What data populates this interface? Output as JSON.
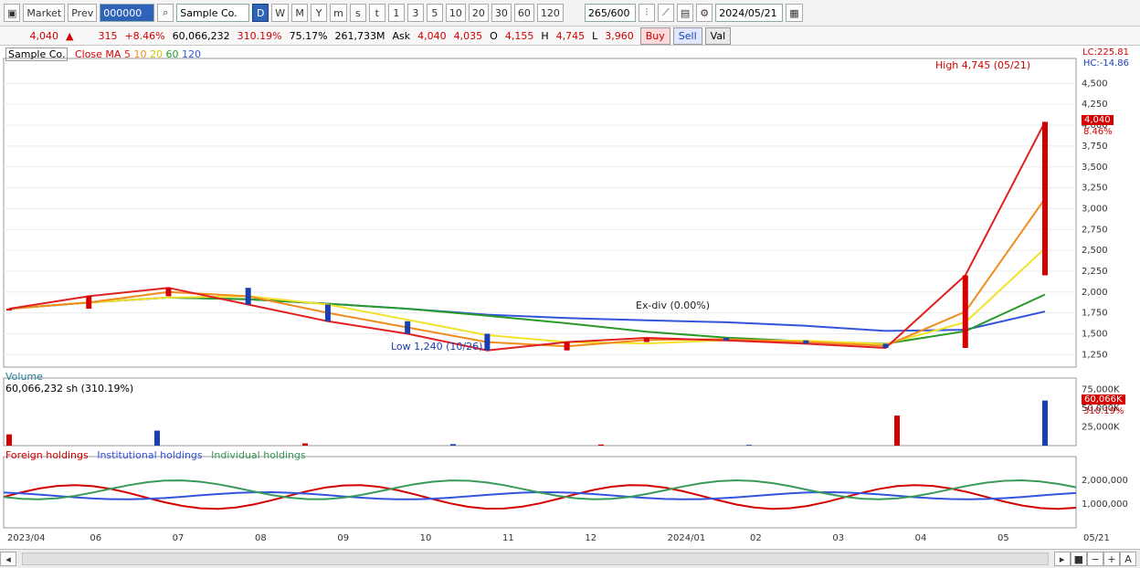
{
  "toolbar": {
    "market": "Market",
    "prev": "Prev",
    "code_value": "000000",
    "name_value": "Sample Co.",
    "periods": [
      "D",
      "W",
      "M",
      "Y",
      "m",
      "s",
      "t"
    ],
    "active_period": "D",
    "intervals": [
      "1",
      "3",
      "5",
      "10",
      "20",
      "30",
      "60",
      "120"
    ],
    "count_value": "265/600",
    "date_value": "2024/05/21"
  },
  "quote": {
    "price": "4,040",
    "change": "315",
    "change_pct": "+8.46%",
    "volume": "60,066,232",
    "volume_ratio": "310.19%",
    "turnover": "75.17%",
    "amount": "261,733M",
    "ask_label": "Ask",
    "ask_value": "4,040",
    "bid_value": "4,035",
    "open_label": "O",
    "open_value": "4,155",
    "high_label": "H",
    "high_value": "4,745",
    "low_label": "L",
    "low_value": "3,960",
    "buy_label": "Buy",
    "sell_label": "Sell",
    "eval_label": "Val"
  },
  "price_pane": {
    "title": "Sample Co.",
    "legend_prefix": "Close MA",
    "ma_periods": [
      "5",
      "10",
      "20",
      "60",
      "120"
    ],
    "lc_text": "LC:225.81",
    "hc_text": "HC:-14.86",
    "current_tag": "4,040",
    "current_pct": "8.46%",
    "high_marker": "High 4,745 (05/21)",
    "low_marker": "Low 1,240 (10/26)",
    "dividend_marker": "Ex-div (0.00%)"
  },
  "volume_pane": {
    "title": "Volume",
    "current": "60,066,232 sh (310.19%)",
    "current_tag": "60,066K",
    "current_pct": "310.19%"
  },
  "holdings_pane": {
    "legend": [
      "Foreign holdings",
      "Institutional holdings",
      "Individual holdings"
    ]
  },
  "x_axis": {
    "labels": [
      "2023/04",
      "06",
      "07",
      "08",
      "09",
      "10",
      "11",
      "12",
      "2024/01",
      "02",
      "03",
      "04",
      "05"
    ],
    "end_label": "05/21"
  },
  "colors": {
    "up": "#d40000",
    "down": "#1a3fb0",
    "ma5": "#e02020",
    "ma10": "#f08c1e",
    "ma20": "#f2e22a",
    "ma60": "#2a9a2a",
    "ma120": "#3355dd",
    "foreign": "#d40000",
    "institution": "#3355dd",
    "individual": "#3a9a5a"
  },
  "chart_data": {
    "type": "line",
    "price_axis": {
      "ticks": [
        1250,
        1500,
        1750,
        2000,
        2250,
        2500,
        2750,
        3000,
        3250,
        3500,
        3750,
        4000,
        4250,
        4500
      ],
      "range": [
        1100,
        4800
      ]
    },
    "volume_axis": {
      "ticks": [
        "25,000K",
        "50,000K",
        "75,000K"
      ],
      "range": [
        0,
        90000
      ]
    },
    "holdings_axis": {
      "ticks": [
        "1,000,000",
        "2,000,000"
      ],
      "range": [
        0,
        3000000
      ]
    },
    "price_series": [
      {
        "x": "2023/04",
        "close": 1800
      },
      {
        "x": "2023/05",
        "close": 1950
      },
      {
        "x": "2023/06",
        "close": 2050
      },
      {
        "x": "2023/07",
        "close": 1850
      },
      {
        "x": "2023/08",
        "close": 1650
      },
      {
        "x": "2023/09",
        "close": 1500
      },
      {
        "x": "2023/10",
        "close": 1300
      },
      {
        "x": "2023/11",
        "close": 1400
      },
      {
        "x": "2023/12",
        "close": 1450
      },
      {
        "x": "2024/01",
        "close": 1420
      },
      {
        "x": "2024/02",
        "close": 1380
      },
      {
        "x": "2024/03",
        "close": 1330
      },
      {
        "x": "2024/04",
        "close": 2200
      },
      {
        "x": "2024/05",
        "close": 4040
      }
    ],
    "volume_series": [
      {
        "x": "2023/04",
        "v": 15000
      },
      {
        "x": "2023/06",
        "v": 20000
      },
      {
        "x": "2023/08",
        "v": 3000
      },
      {
        "x": "2023/10",
        "v": 2000
      },
      {
        "x": "2023/12",
        "v": 1500
      },
      {
        "x": "2024/02",
        "v": 1000
      },
      {
        "x": "2024/04",
        "v": 40000
      },
      {
        "x": "2024/05",
        "v": 60066
      }
    ]
  }
}
